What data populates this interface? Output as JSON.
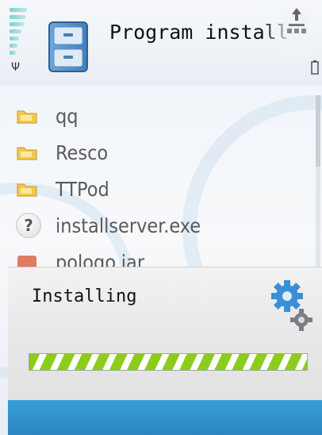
{
  "header": {
    "title": "Program install",
    "signal_icon": "signal-strength-icon",
    "app_icon": "file-cabinet-icon",
    "network_icon": "network-transfer-icon",
    "battery_icon": "battery-icon"
  },
  "file_list": {
    "items": [
      {
        "label": "qq",
        "icon": "folder-icon"
      },
      {
        "label": "Resco",
        "icon": "folder-icon"
      },
      {
        "label": "TTPod",
        "icon": "folder-icon"
      },
      {
        "label": "installserver.exe",
        "icon": "unknown-file-icon"
      },
      {
        "label": "pologo.jar",
        "icon": "jar-file-icon"
      }
    ]
  },
  "dialog": {
    "message": "Installing",
    "icon": "gears-icon",
    "unknown_glyph": "?"
  },
  "colors": {
    "accent_blue": "#2b86c2",
    "progress_green": "#8ccc1c",
    "folder_yellow": "#f2c94c"
  }
}
